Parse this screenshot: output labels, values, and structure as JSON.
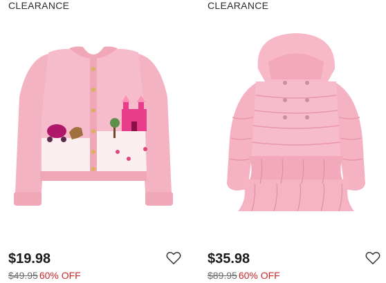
{
  "products": [
    {
      "badge": "CLEARANCE",
      "price": "$19.98",
      "original_price": "$49.95",
      "discount": "60% OFF",
      "image_icon": "pink-cardigan-castle-image",
      "wishlist_icon": "heart-outline-icon"
    },
    {
      "badge": "CLEARANCE",
      "price": "$35.98",
      "original_price": "$89.95",
      "discount": "60% OFF",
      "image_icon": "pink-puffer-jacket-image",
      "wishlist_icon": "heart-outline-icon"
    }
  ],
  "colors": {
    "sale_red": "#c8282e",
    "text": "#1a1a1a",
    "strike_grey": "#6b6b6b",
    "garment_pink": "#f4b3c2"
  }
}
